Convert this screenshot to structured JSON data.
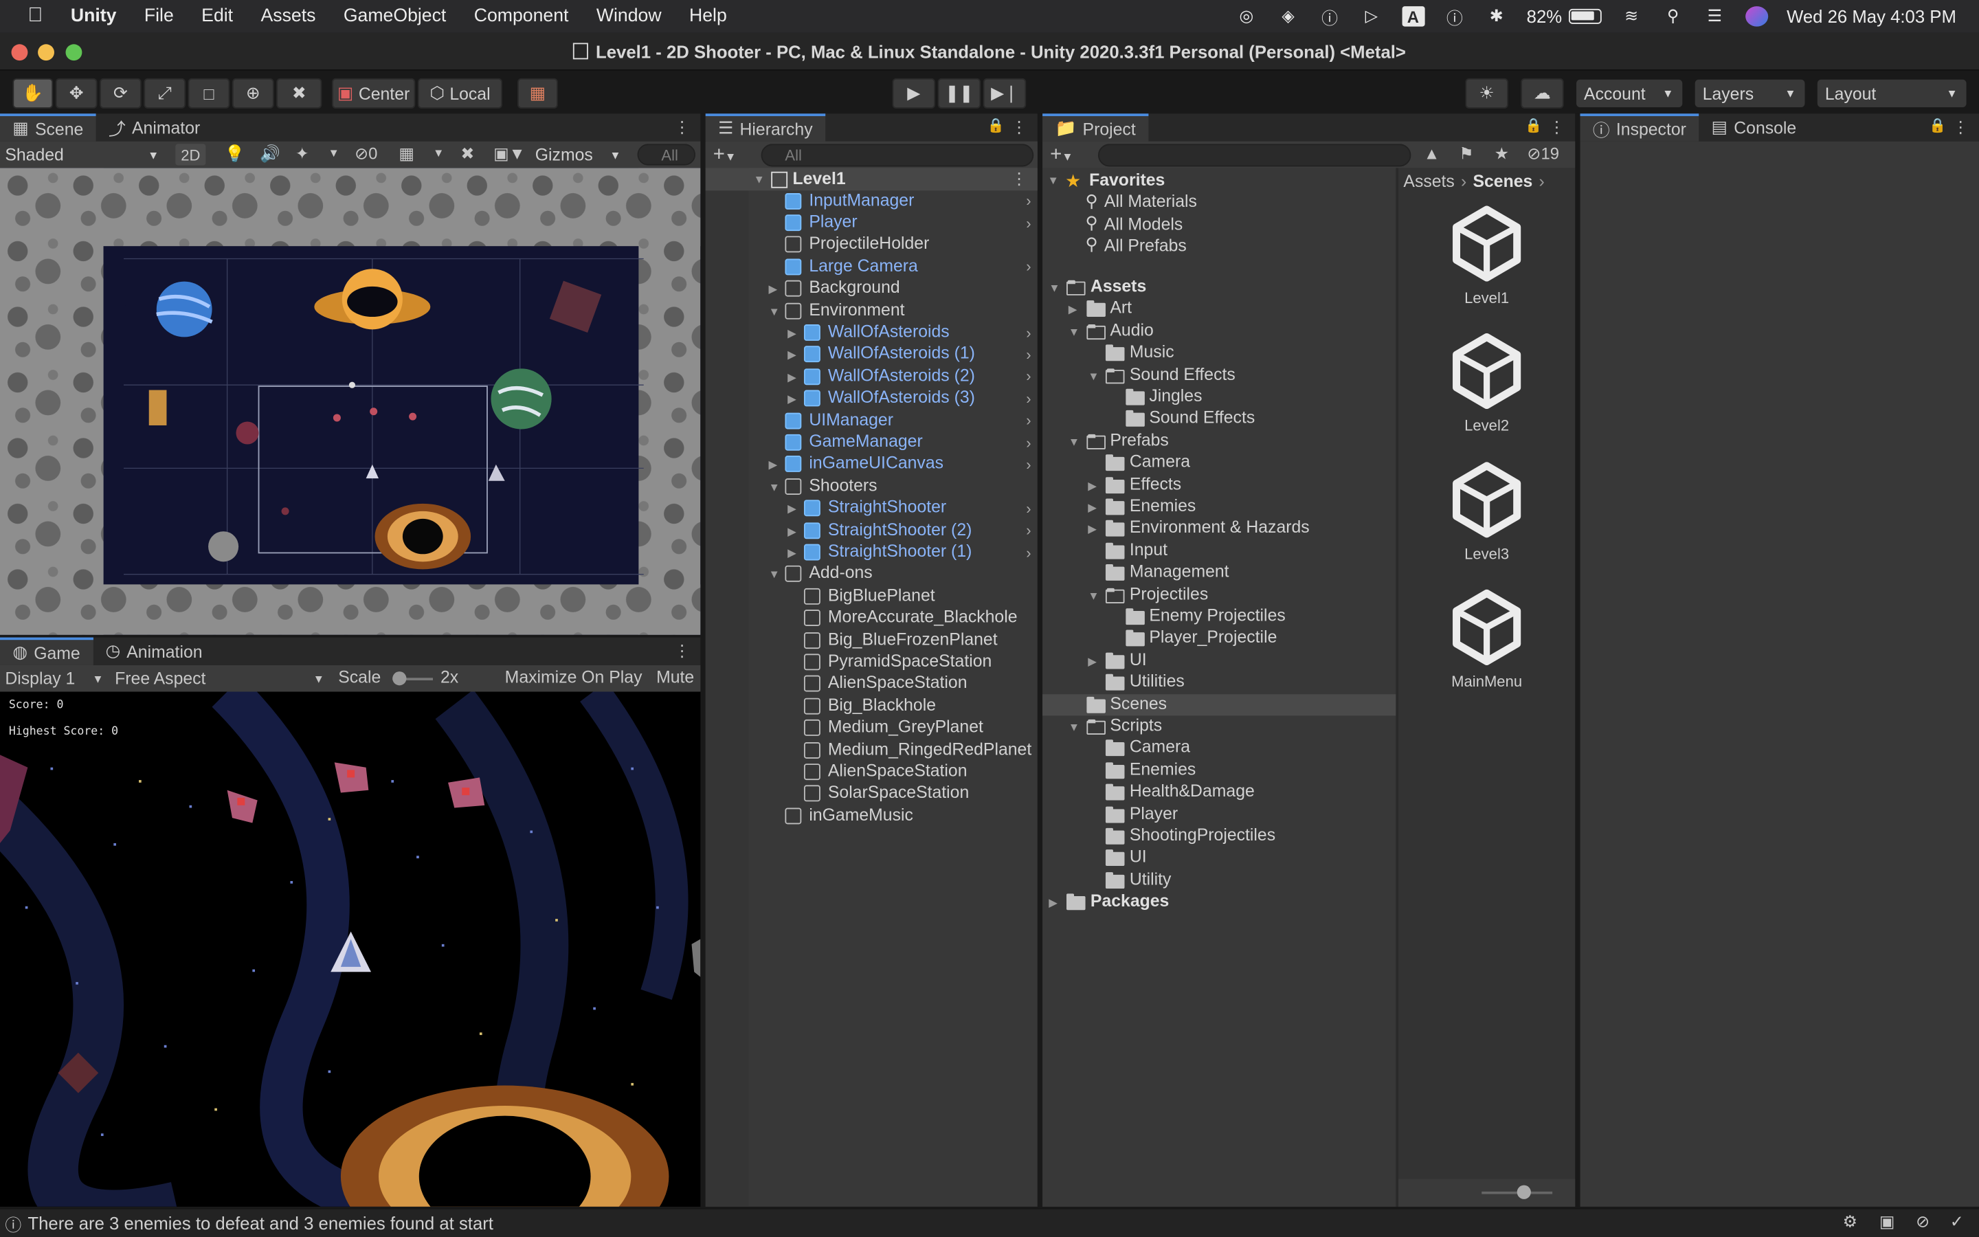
{
  "menubar": {
    "app": "Unity",
    "items": [
      "File",
      "Edit",
      "Assets",
      "GameObject",
      "Component",
      "Window",
      "Help"
    ],
    "battery": "82%",
    "datetime": "Wed 26 May  4:03 PM"
  },
  "window": {
    "title": "Level1 - 2D Shooter - PC, Mac & Linux Standalone - Unity 2020.3.3f1 Personal (Personal) <Metal>"
  },
  "toolbar": {
    "pivot": "Center",
    "space": "Local",
    "account": "Account",
    "layers": "Layers",
    "layout": "Layout"
  },
  "scene": {
    "tabs": [
      "Scene",
      "Animator"
    ],
    "shading": "Shaded",
    "mode2d": "2D",
    "hidden_count": "0",
    "gizmos": "Gizmos",
    "search_placeholder": "All"
  },
  "game": {
    "tabs": [
      "Game",
      "Animation"
    ],
    "display": "Display 1",
    "aspect": "Free Aspect",
    "scale_label": "Scale",
    "scale_value": "2x",
    "maximize": "Maximize On Play",
    "mute": "Mute",
    "score": "Score: 0",
    "highscore": "Highest Score: 0"
  },
  "hierarchy": {
    "tab": "Hierarchy",
    "search_placeholder": "All",
    "scene_name": "Level1",
    "items": [
      {
        "label": "InputManager",
        "depth": 1,
        "blue": true,
        "arrow": false,
        "chevron": true
      },
      {
        "label": "Player",
        "depth": 1,
        "blue": true,
        "arrow": false,
        "chevron": true
      },
      {
        "label": "ProjectileHolder",
        "depth": 1,
        "blue": false,
        "arrow": false,
        "chevron": false
      },
      {
        "label": "Large Camera",
        "depth": 1,
        "blue": true,
        "arrow": false,
        "chevron": true
      },
      {
        "label": "Background",
        "depth": 1,
        "blue": false,
        "arrow": "right",
        "chevron": false
      },
      {
        "label": "Environment",
        "depth": 1,
        "blue": false,
        "arrow": "down",
        "chevron": false
      },
      {
        "label": "WallOfAsteroids",
        "depth": 2,
        "blue": true,
        "arrow": "right",
        "chevron": true
      },
      {
        "label": "WallOfAsteroids (1)",
        "depth": 2,
        "blue": true,
        "arrow": "right",
        "chevron": true
      },
      {
        "label": "WallOfAsteroids (2)",
        "depth": 2,
        "blue": true,
        "arrow": "right",
        "chevron": true
      },
      {
        "label": "WallOfAsteroids (3)",
        "depth": 2,
        "blue": true,
        "arrow": "right",
        "chevron": true
      },
      {
        "label": "UIManager",
        "depth": 1,
        "blue": true,
        "arrow": false,
        "chevron": true
      },
      {
        "label": "GameManager",
        "depth": 1,
        "blue": true,
        "arrow": false,
        "chevron": true
      },
      {
        "label": "inGameUICanvas",
        "depth": 1,
        "blue": true,
        "arrow": "right",
        "chevron": true
      },
      {
        "label": "Shooters",
        "depth": 1,
        "blue": false,
        "arrow": "down",
        "chevron": false
      },
      {
        "label": "StraightShooter",
        "depth": 2,
        "blue": true,
        "arrow": "right",
        "chevron": true
      },
      {
        "label": "StraightShooter (2)",
        "depth": 2,
        "blue": true,
        "arrow": "right",
        "chevron": true
      },
      {
        "label": "StraightShooter (1)",
        "depth": 2,
        "blue": true,
        "arrow": "right",
        "chevron": true
      },
      {
        "label": "Add-ons",
        "depth": 1,
        "blue": false,
        "arrow": "down",
        "chevron": false
      },
      {
        "label": "BigBluePlanet",
        "depth": 2,
        "blue": false,
        "arrow": false,
        "chevron": false
      },
      {
        "label": "MoreAccurate_Blackhole",
        "depth": 2,
        "blue": false,
        "arrow": false,
        "chevron": false
      },
      {
        "label": "Big_BlueFrozenPlanet",
        "depth": 2,
        "blue": false,
        "arrow": false,
        "chevron": false
      },
      {
        "label": "PyramidSpaceStation",
        "depth": 2,
        "blue": false,
        "arrow": false,
        "chevron": false
      },
      {
        "label": "AlienSpaceStation",
        "depth": 2,
        "blue": false,
        "arrow": false,
        "chevron": false
      },
      {
        "label": "Big_Blackhole",
        "depth": 2,
        "blue": false,
        "arrow": false,
        "chevron": false
      },
      {
        "label": "Medium_GreyPlanet",
        "depth": 2,
        "blue": false,
        "arrow": false,
        "chevron": false
      },
      {
        "label": "Medium_RingedRedPlanet",
        "depth": 2,
        "blue": false,
        "arrow": false,
        "chevron": false
      },
      {
        "label": "AlienSpaceStation",
        "depth": 2,
        "blue": false,
        "arrow": false,
        "chevron": false
      },
      {
        "label": "SolarSpaceStation",
        "depth": 2,
        "blue": false,
        "arrow": false,
        "chevron": false
      },
      {
        "label": "inGameMusic",
        "depth": 1,
        "blue": false,
        "arrow": false,
        "chevron": false
      }
    ]
  },
  "project": {
    "tab": "Project",
    "hidden_count": "19",
    "favorites_label": "Favorites",
    "favorites": [
      "All Materials",
      "All Models",
      "All Prefabs"
    ],
    "tree": [
      {
        "label": "Assets",
        "depth": 0,
        "arrow": "down",
        "bold": true,
        "open": true
      },
      {
        "label": "Art",
        "depth": 1,
        "arrow": "right",
        "open": false
      },
      {
        "label": "Audio",
        "depth": 1,
        "arrow": "down",
        "open": true
      },
      {
        "label": "Music",
        "depth": 2,
        "arrow": false,
        "open": false
      },
      {
        "label": "Sound Effects",
        "depth": 2,
        "arrow": "down",
        "open": true
      },
      {
        "label": "Jingles",
        "depth": 3,
        "arrow": false,
        "open": false
      },
      {
        "label": "Sound Effects",
        "depth": 3,
        "arrow": false,
        "open": false
      },
      {
        "label": "Prefabs",
        "depth": 1,
        "arrow": "down",
        "open": true
      },
      {
        "label": "Camera",
        "depth": 2,
        "arrow": false,
        "open": false
      },
      {
        "label": "Effects",
        "depth": 2,
        "arrow": "right",
        "open": false
      },
      {
        "label": "Enemies",
        "depth": 2,
        "arrow": "right",
        "open": false
      },
      {
        "label": "Environment & Hazards",
        "depth": 2,
        "arrow": "right",
        "open": false
      },
      {
        "label": "Input",
        "depth": 2,
        "arrow": false,
        "open": false
      },
      {
        "label": "Management",
        "depth": 2,
        "arrow": false,
        "open": false
      },
      {
        "label": "Projectiles",
        "depth": 2,
        "arrow": "down",
        "open": true
      },
      {
        "label": "Enemy Projectiles",
        "depth": 3,
        "arrow": false,
        "open": false
      },
      {
        "label": "Player_Projectile",
        "depth": 3,
        "arrow": false,
        "open": false
      },
      {
        "label": "UI",
        "depth": 2,
        "arrow": "right",
        "open": false
      },
      {
        "label": "Utilities",
        "depth": 2,
        "arrow": false,
        "open": false
      },
      {
        "label": "Scenes",
        "depth": 1,
        "arrow": false,
        "open": false,
        "selected": true
      },
      {
        "label": "Scripts",
        "depth": 1,
        "arrow": "down",
        "open": true
      },
      {
        "label": "Camera",
        "depth": 2,
        "arrow": false,
        "open": false
      },
      {
        "label": "Enemies",
        "depth": 2,
        "arrow": false,
        "open": false
      },
      {
        "label": "Health&Damage",
        "depth": 2,
        "arrow": false,
        "open": false
      },
      {
        "label": "Player",
        "depth": 2,
        "arrow": false,
        "open": false
      },
      {
        "label": "ShootingProjectiles",
        "depth": 2,
        "arrow": false,
        "open": false
      },
      {
        "label": "UI",
        "depth": 2,
        "arrow": false,
        "open": false
      },
      {
        "label": "Utility",
        "depth": 2,
        "arrow": false,
        "open": false
      },
      {
        "label": "Packages",
        "depth": 0,
        "arrow": "right",
        "bold": true,
        "open": false
      }
    ],
    "breadcrumb": [
      "Assets",
      "Scenes"
    ],
    "assets": [
      "Level1",
      "Level2",
      "Level3",
      "MainMenu"
    ]
  },
  "inspector": {
    "tabs": [
      "Inspector",
      "Console"
    ]
  },
  "status": {
    "message": "There are 3 enemies to defeat and 3 enemies found at start"
  }
}
